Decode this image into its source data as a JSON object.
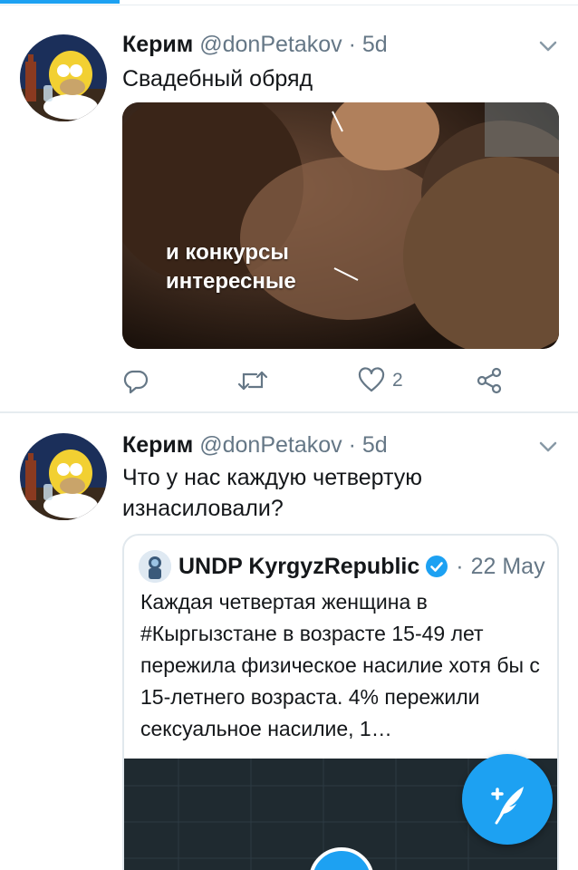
{
  "tweets": [
    {
      "author_name": "Керим",
      "handle": "@donPetakov",
      "separator": "·",
      "time": "5d",
      "text": "Свадебный обряд",
      "media_caption_line1": "и конкурсы",
      "media_caption_line2": "интересные",
      "actions": {
        "reply_icon": "reply-icon",
        "retweet_icon": "retweet-icon",
        "like_icon": "heart-icon",
        "like_count": "2",
        "share_icon": "share-icon"
      }
    },
    {
      "author_name": "Керим",
      "handle": "@donPetakov",
      "separator": "·",
      "time": "5d",
      "text_line1": "Что у нас каждую четвертую",
      "text_line2": "изнасиловали?",
      "quote": {
        "name": "UNDP KyrgyzRepublic",
        "separator": "·",
        "date": "22 May",
        "text": "Каждая четвертая женщина в #Кыргызстане в возрасте 15-49 лет пережила физическое насилие хотя бы с 15-летнего возраста. 4% пережили сексуальное насилие, 1…"
      }
    }
  ],
  "colors": {
    "accent": "#1da1f2",
    "secondary_text": "#657786",
    "divider": "#e6ecf0"
  },
  "fab_icon": "compose-tweet-icon"
}
